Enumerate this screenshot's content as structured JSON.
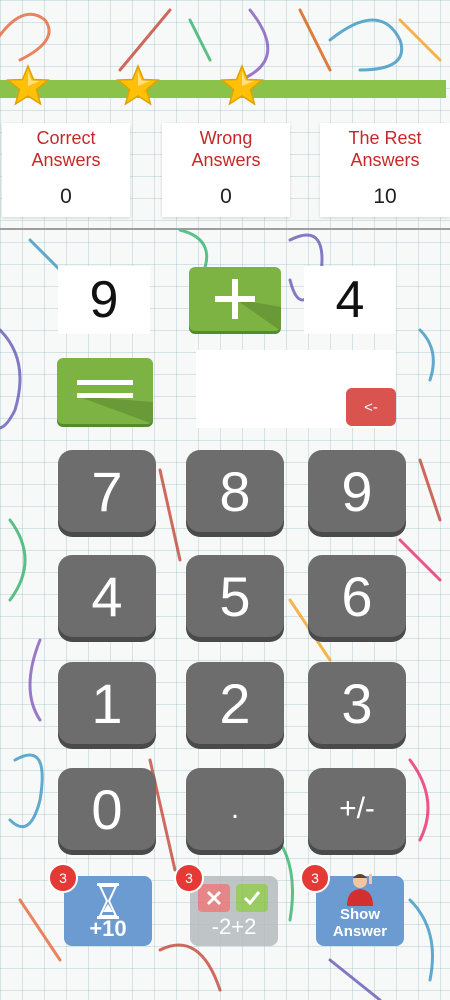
{
  "progress": {
    "stars_count": 3,
    "fill_fraction": 1.0
  },
  "scores": {
    "correct": {
      "label_line1": "Correct",
      "label_line2": "Answers",
      "value": "0"
    },
    "wrong": {
      "label_line1": "Wrong",
      "label_line2": "Answers",
      "value": "0"
    },
    "rest": {
      "label_line1": "The Rest",
      "label_line2": "Answers",
      "value": "10"
    }
  },
  "problem": {
    "operand1": "9",
    "operator": "+",
    "operand2": "4",
    "answer": ""
  },
  "backspace_label": "<-",
  "keypad": {
    "keys": [
      "7",
      "8",
      "9",
      "4",
      "5",
      "6",
      "1",
      "2",
      "3",
      "0",
      ".",
      "+/-"
    ]
  },
  "helpers": {
    "time": {
      "badge": "3",
      "label": "+10",
      "icon": "hourglass-icon"
    },
    "fifty": {
      "badge": "3",
      "left_label": "-2",
      "right_label": "+2",
      "icons": [
        "x-icon",
        "check-icon"
      ]
    },
    "show": {
      "badge": "3",
      "line1": "Show",
      "line2": "Answer",
      "icon": "person-icon"
    }
  },
  "colors": {
    "green": "#7cb342",
    "red": "#c62828",
    "key_gray": "#6d6d6d",
    "helper_blue": "#6b9bd1",
    "badge_red": "#e53935"
  }
}
